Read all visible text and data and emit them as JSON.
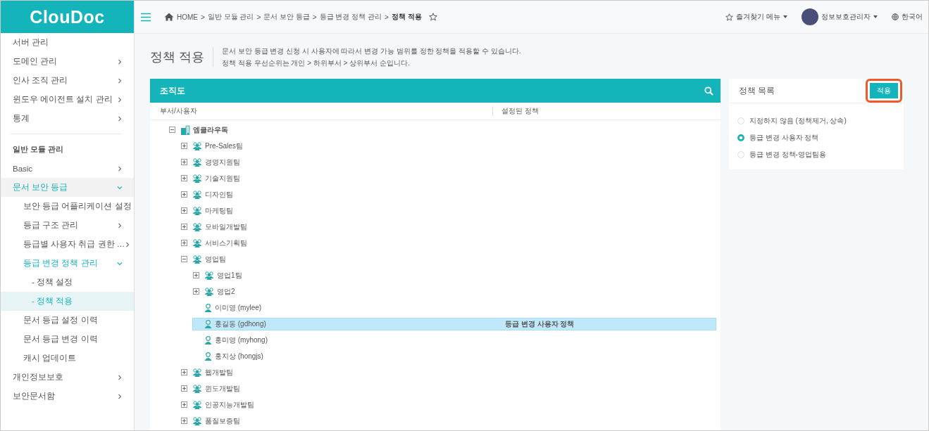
{
  "sidebar": {
    "logo": "ClouDoc",
    "sections": [
      {
        "items": [
          {
            "label": "서버 관리",
            "selected": false
          },
          {
            "label": "도메인 관리",
            "selected": false,
            "expanded": false
          },
          {
            "label": "인사 조직 관리",
            "selected": false,
            "expanded": false
          },
          {
            "label": "윈도우 에이전트 설치 관리",
            "selected": false,
            "expanded": false
          },
          {
            "label": "통계",
            "selected": false,
            "expanded": false
          }
        ]
      },
      {
        "heading": "일반 모듈 관리",
        "items": [
          {
            "label": "Basic",
            "selected": false,
            "expanded": false
          },
          {
            "label": "문서 보안 등급",
            "selected": false,
            "expanded": true,
            "children": [
              {
                "label": "보안 등급 어플리케이션 설정",
                "selected": false
              },
              {
                "label": "등급 구조 관리",
                "selected": false,
                "expanded": false
              },
              {
                "label": "등급별 사용자 취급 권한 …",
                "selected": false,
                "expanded": false
              },
              {
                "label": "등급 변경 정책 관리",
                "selected": false,
                "expanded": true,
                "children": [
                  {
                    "label": "- 정책 설정",
                    "selected": false
                  },
                  {
                    "label": "- 정책 적용",
                    "selected": true
                  }
                ]
              },
              {
                "label": "문서 등급 설정 이력",
                "selected": false
              },
              {
                "label": "문서 등급 변경 이력",
                "selected": false
              },
              {
                "label": "캐시 업데이트",
                "selected": false
              }
            ]
          },
          {
            "label": "개인정보보호",
            "selected": false,
            "expanded": false
          },
          {
            "label": "보안문서함",
            "selected": false,
            "expanded": false
          }
        ]
      }
    ]
  },
  "topbar": {
    "breadcrumb": {
      "separator": ">",
      "items": [
        {
          "label": "HOME",
          "current": false
        },
        {
          "label": "일반 모듈 관리",
          "current": false
        },
        {
          "label": "문서 보안 등급",
          "current": false
        },
        {
          "label": "등급 변경 정책 관리",
          "current": false
        },
        {
          "label": "정책 적용",
          "current": true
        }
      ]
    },
    "favorites": "즐겨찾기 메뉴",
    "user": "정보보호관리자",
    "language": "한국어"
  },
  "page": {
    "title": "정책 적용",
    "description": [
      "문서 보안 등급 변경 신청 시 사용자에 따라서 변경 가능 범위를 정한 정책을 적용할 수 있습니다.",
      "정책 적용 우선순위는 개인 > 하위부서 > 상위부서 순입니다."
    ]
  },
  "org_panel": {
    "title": "조직도",
    "columns": [
      "부서/사용자",
      "설정된 정책"
    ],
    "tree": [
      {
        "label": "엠클라우독",
        "kind": "root",
        "expanded": true,
        "selected": false,
        "children": [
          {
            "label": "Pre-Sales팀",
            "kind": "dept",
            "expanded": false,
            "selected": false
          },
          {
            "label": "경영지원팀",
            "kind": "dept",
            "expanded": false,
            "selected": false
          },
          {
            "label": "기술지원팀",
            "kind": "dept",
            "expanded": false,
            "selected": false
          },
          {
            "label": "디자인팀",
            "kind": "dept",
            "expanded": false,
            "selected": false
          },
          {
            "label": "마케팅팀",
            "kind": "dept",
            "expanded": false,
            "selected": false
          },
          {
            "label": "모바일개발팀",
            "kind": "dept",
            "expanded": false,
            "selected": false
          },
          {
            "label": "서비스기획팀",
            "kind": "dept",
            "expanded": false,
            "selected": false
          },
          {
            "label": "영업팀",
            "kind": "dept",
            "expanded": true,
            "selected": false,
            "children": [
              {
                "label": "영업1팀",
                "kind": "dept",
                "expanded": false,
                "selected": false
              },
              {
                "label": "영업2",
                "kind": "dept",
                "expanded": false,
                "selected": false
              },
              {
                "label": "이미영 (mylee)",
                "kind": "user",
                "selected": false
              },
              {
                "label": "홍길동 (gdhong)",
                "kind": "user",
                "selected": true,
                "policy": "등급 변경 사용자 정책"
              },
              {
                "label": "홍미영 (myhong)",
                "kind": "user",
                "selected": false
              },
              {
                "label": "홍지상 (hongjs)",
                "kind": "user",
                "selected": false
              }
            ]
          },
          {
            "label": "웹개발팀",
            "kind": "dept",
            "expanded": false,
            "selected": false
          },
          {
            "label": "윈도개발팀",
            "kind": "dept",
            "expanded": false,
            "selected": false
          },
          {
            "label": "인공지능개발팀",
            "kind": "dept",
            "expanded": false,
            "selected": false
          },
          {
            "label": "품질보증팀",
            "kind": "dept",
            "expanded": false,
            "selected": false
          }
        ]
      }
    ]
  },
  "policy_panel": {
    "title": "정책 목록",
    "apply_button": "적용",
    "options": [
      {
        "label": "지정하지 않음 (정책제거, 상속)",
        "selected": false
      },
      {
        "label": "등급 변경 사용자 정책",
        "selected": true
      },
      {
        "label": "등급 변경 정책-영업팀용",
        "selected": false
      }
    ]
  }
}
